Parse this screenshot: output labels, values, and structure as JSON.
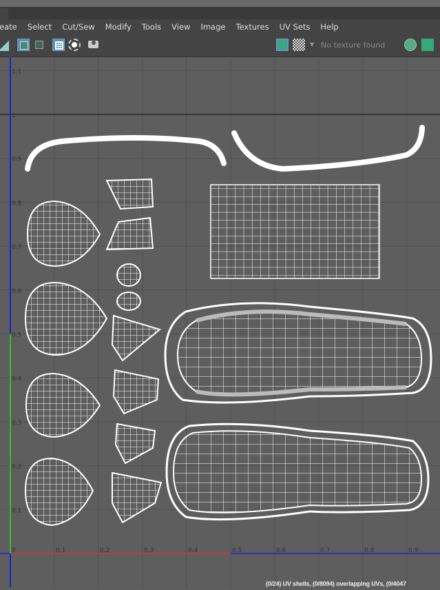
{
  "menu": {
    "items": [
      "eate",
      "Select",
      "Cut/Sew",
      "Modify",
      "Tools",
      "View",
      "Image",
      "Textures",
      "UV Sets",
      "Help"
    ]
  },
  "toolbar": {
    "texture_status": "No texture found",
    "icons": [
      "uv-shell-icon",
      "wireframe-toggle-icon",
      "shaded-toggle-icon",
      "grid-icon",
      "dim-icon",
      "snapshot-icon",
      "image-display-icon",
      "checker-icon",
      "dropdown-arrow-icon",
      "rgb-icon",
      "image-icon"
    ]
  },
  "viewport": {
    "u_ticks": [
      "0",
      "0.1",
      "0.2",
      "0.3",
      "0.4",
      "0.5",
      "0.6",
      "0.7",
      "0.8",
      "0.9"
    ],
    "v_ticks": [
      "0.1",
      "0.2",
      "0.3",
      "0.4",
      "0.5",
      "0.6",
      "0.7",
      "0.8",
      "0.9",
      "1",
      "1.1"
    ],
    "colors": {
      "u_axis_red": "#b04040",
      "u_axis_blue": "#3030c0",
      "v_axis_green": "#30c030",
      "v_axis_blue": "#2020d0",
      "background": "#5e5e5e",
      "wire": "#ffffff"
    }
  },
  "status": "(0/24) UV shells, (0/8094) overlapping UVs, (0/4047"
}
